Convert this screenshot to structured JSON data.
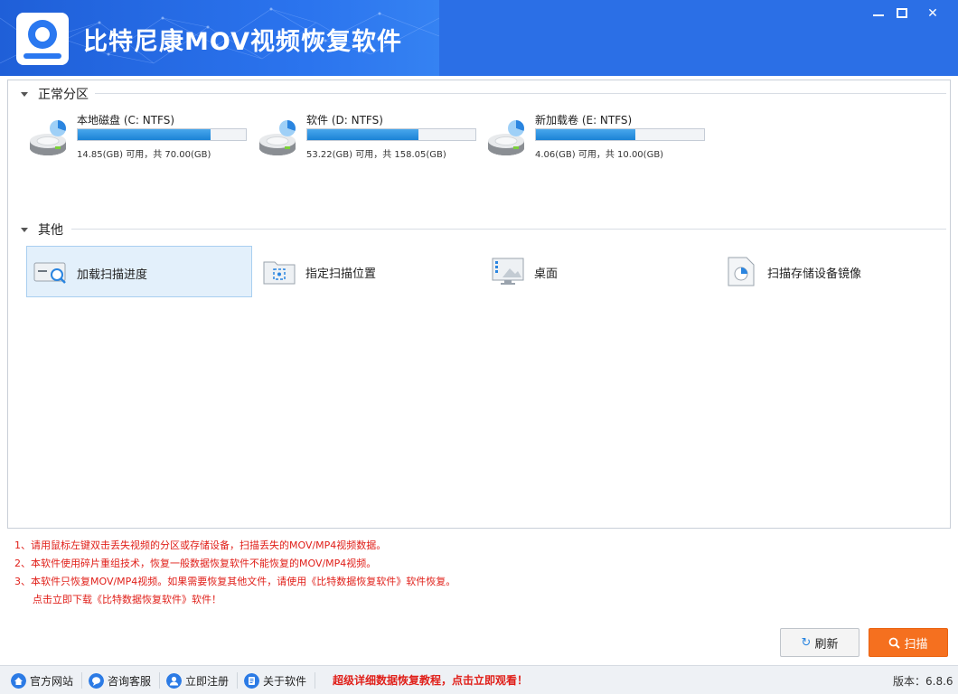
{
  "app": {
    "title": "比特尼康MOV视频恢复软件"
  },
  "sections": {
    "normal_partitions": "正常分区",
    "other": "其他"
  },
  "drives": [
    {
      "name": "本地磁盘 (C: NTFS)",
      "info": "14.85(GB) 可用，共 70.00(GB)",
      "used_fraction": 0.79
    },
    {
      "name": "软件 (D: NTFS)",
      "info": "53.22(GB) 可用，共 158.05(GB)",
      "used_fraction": 0.66
    },
    {
      "name": "新加载卷 (E: NTFS)",
      "info": "4.06(GB) 可用，共 10.00(GB)",
      "used_fraction": 0.59
    }
  ],
  "others": [
    {
      "label": "加载扫描进度",
      "icon": "load-scan-icon",
      "selected": true
    },
    {
      "label": "指定扫描位置",
      "icon": "folder-target-icon",
      "selected": false
    },
    {
      "label": "桌面",
      "icon": "desktop-icon",
      "selected": false
    },
    {
      "label": "扫描存储设备镜像",
      "icon": "disk-image-icon",
      "selected": false
    }
  ],
  "tips": [
    "1、请用鼠标左键双击丢失视频的分区或存储设备，扫描丢失的MOV/MP4视频数据。",
    "2、本软件使用碎片重组技术，恢复一般数据恢复软件不能恢复的MOV/MP4视频。",
    "3、本软件只恢复MOV/MP4视频。如果需要恢复其他文件，请使用《比特数据恢复软件》软件恢复。",
    "点击立即下载《比特数据恢复软件》软件！"
  ],
  "buttons": {
    "refresh": "刷新",
    "scan": "扫描"
  },
  "footer": {
    "website": "官方网站",
    "support": "咨询客服",
    "register": "立即注册",
    "about": "关于软件",
    "promo": "超级详细数据恢复教程，点击立即观看！",
    "version": "版本：6.8.6"
  },
  "colors": {
    "title_bar": "#2b6fe6",
    "progress_fill": "#1b82d6",
    "scan_button": "#f5701f",
    "tip_text": "#e0201a",
    "selected_bg": "#e3f0fb"
  }
}
